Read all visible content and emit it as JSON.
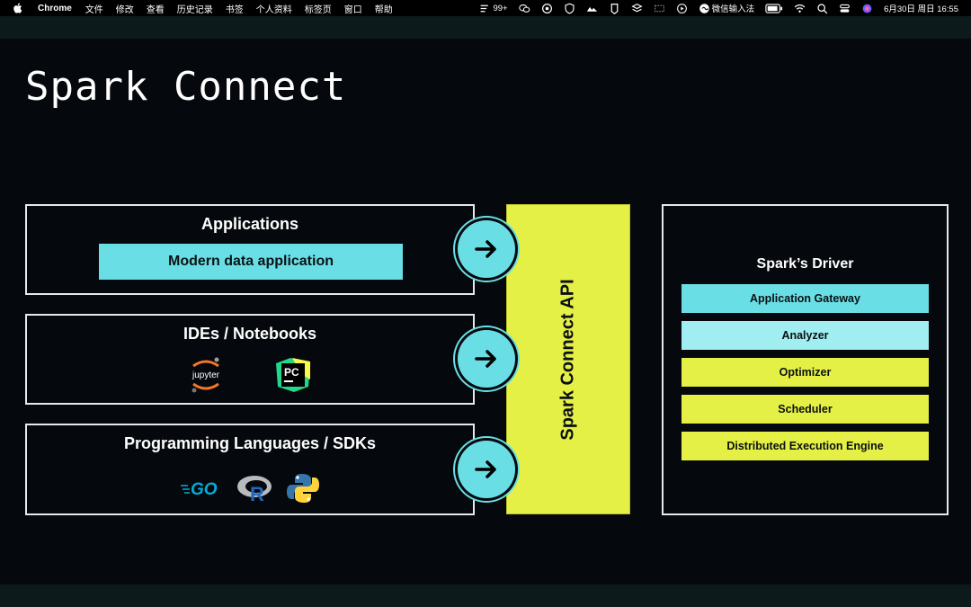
{
  "menubar": {
    "app_name": "Chrome",
    "items": [
      "文件",
      "修改",
      "查看",
      "历史记录",
      "书签",
      "个人资料",
      "标签页",
      "窗口",
      "帮助"
    ],
    "notification_count": "99+",
    "input_method": "微信输入法",
    "clock": "6月30日 周日  16:55"
  },
  "slide": {
    "title": "Spark Connect",
    "applications": {
      "title": "Applications",
      "item": "Modern data application"
    },
    "ides": {
      "title": "IDEs / Notebooks",
      "logos": [
        "jupyter-logo",
        "pycharm-logo"
      ],
      "jupyter_text": "jupyter",
      "pycharm_text": "PC"
    },
    "languages": {
      "title": "Programming Languages / SDKs",
      "logos": [
        "go-logo",
        "r-logo",
        "python-logo"
      ],
      "go_text": "GO",
      "r_text": "R"
    },
    "api": {
      "label": "Spark Connect API"
    },
    "driver": {
      "title": "Spark’s Driver",
      "layers": [
        {
          "label": "Application Gateway",
          "color": "#69dfe5"
        },
        {
          "label": "Analyzer",
          "color": "#a0eef0"
        },
        {
          "label": "Optimizer",
          "color": "#e4f045"
        },
        {
          "label": "Scheduler",
          "color": "#e4f045"
        },
        {
          "label": "Distributed Execution Engine",
          "color": "#e4f045"
        }
      ]
    },
    "colors": {
      "background": "#05080c",
      "cyan": "#69dfe5",
      "light_cyan": "#a0eef0",
      "yellow": "#e4f045"
    }
  }
}
